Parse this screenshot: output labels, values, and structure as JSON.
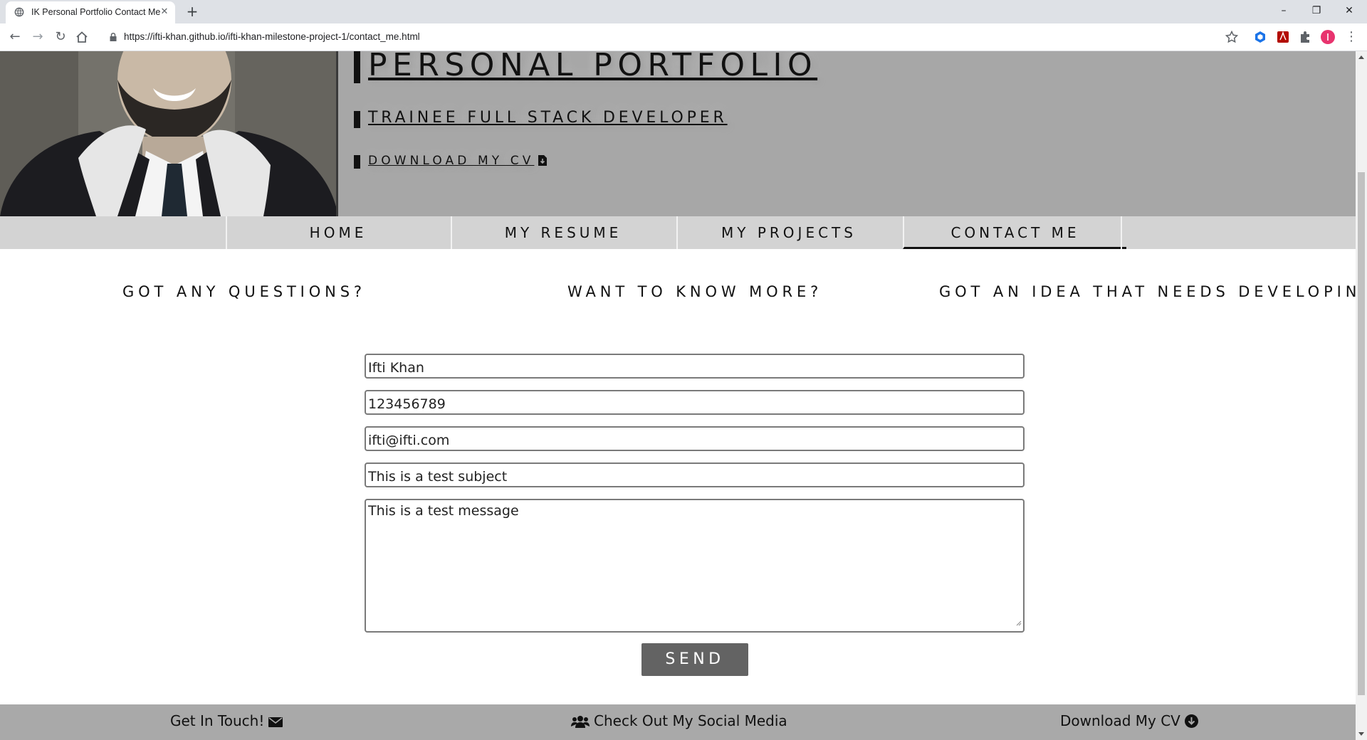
{
  "browser": {
    "tab_title": "IK Personal Portfolio Contact Me",
    "url": "https://ifti-khan.github.io/ifti-khan-milestone-project-1/contact_me.html"
  },
  "header": {
    "title": "PERSONAL PORTFOLIO",
    "subtitle": "TRAINEE FULL STACK DEVELOPER",
    "download_cv": "DOWNLOAD MY CV"
  },
  "nav": {
    "items": [
      "HOME",
      "MY RESUME",
      "MY PROJECTS",
      "CONTACT ME"
    ],
    "active": "CONTACT ME"
  },
  "taglines": [
    "GOT ANY QUESTIONS?",
    "WANT TO KNOW MORE?",
    "GOT AN IDEA THAT NEEDS DEVELOPING?"
  ],
  "form": {
    "name": "Ifti Khan",
    "phone": "123456789",
    "email": "ifti@ifti.com",
    "subject": "This is a test subject",
    "message": "This is a test message",
    "send_label": "SEND"
  },
  "footer": {
    "contact": "Get In Touch!",
    "social": "Check Out My Social Media",
    "cv": "Download My CV"
  },
  "icons": {
    "tab_favicon": "globe-icon",
    "cv_icon": "file-download-icon",
    "contact_icon": "envelope-icon",
    "social_icon": "users-icon",
    "cv_footer_icon": "arrow-circle-down-icon"
  },
  "colors": {
    "header_bg": "#a7a7a7",
    "nav_bg": "#d3d3d3",
    "send_bg": "#636363",
    "footer_bg": "#a9a9a9",
    "profile_avatar": "#e8336e"
  }
}
